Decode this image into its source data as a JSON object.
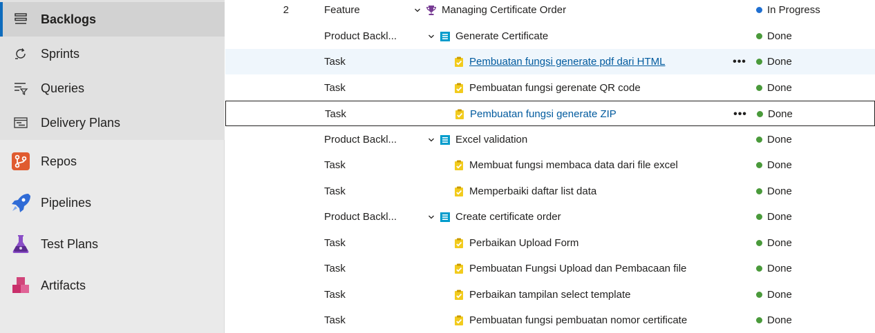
{
  "sidebar": {
    "sub_items": [
      {
        "label": "Backlogs",
        "icon": "backlogs-icon",
        "selected": true
      },
      {
        "label": "Sprints",
        "icon": "sprints-icon",
        "selected": false
      },
      {
        "label": "Queries",
        "icon": "queries-icon",
        "selected": false
      },
      {
        "label": "Delivery Plans",
        "icon": "delivery-plans-icon",
        "selected": false
      }
    ],
    "main_items": [
      {
        "label": "Repos",
        "icon": "repos-icon",
        "color": "#e05b2f"
      },
      {
        "label": "Pipelines",
        "icon": "pipelines-icon",
        "color": "#2f6bd6"
      },
      {
        "label": "Test Plans",
        "icon": "test-plans-icon",
        "color": "#7a3fb0"
      },
      {
        "label": "Artifacts",
        "icon": "artifacts-icon",
        "color": "#d1457a"
      }
    ]
  },
  "colors": {
    "in_progress": "#1f6fd1",
    "done": "#4a9a3b",
    "feature_icon": "#773b93",
    "pbi_icon": "#009ccc",
    "task_icon": "#f2cb1d"
  },
  "backlog": {
    "rows": [
      {
        "order": "2",
        "type": "Feature",
        "level": 0,
        "expandable": true,
        "icon": "trophy-icon",
        "title": "Managing Certificate Order",
        "state": "In Progress",
        "state_color": "#1f6fd1"
      },
      {
        "order": "",
        "type": "Product Backl...",
        "level": 1,
        "expandable": true,
        "icon": "product-backlog-item-icon",
        "title": "Generate Certificate",
        "state": "Done",
        "state_color": "#4a9a3b"
      },
      {
        "order": "",
        "type": "Task",
        "level": 2,
        "expandable": false,
        "icon": "task-icon",
        "title": "Pembuatan fungsi generate pdf dari HTML",
        "state": "Done",
        "state_color": "#4a9a3b",
        "hover": true
      },
      {
        "order": "",
        "type": "Task",
        "level": 2,
        "expandable": false,
        "icon": "task-icon",
        "title": "Pembuatan fungsi gerenate QR code",
        "state": "Done",
        "state_color": "#4a9a3b"
      },
      {
        "order": "",
        "type": "Task",
        "level": 2,
        "expandable": false,
        "icon": "task-icon",
        "title": "Pembuatan fungsi generate ZIP",
        "state": "Done",
        "state_color": "#4a9a3b",
        "focused": true
      },
      {
        "order": "",
        "type": "Product Backl...",
        "level": 1,
        "expandable": true,
        "icon": "product-backlog-item-icon",
        "title": "Excel validation",
        "state": "Done",
        "state_color": "#4a9a3b"
      },
      {
        "order": "",
        "type": "Task",
        "level": 2,
        "expandable": false,
        "icon": "task-icon",
        "title": "Membuat fungsi membaca data dari file excel",
        "state": "Done",
        "state_color": "#4a9a3b"
      },
      {
        "order": "",
        "type": "Task",
        "level": 2,
        "expandable": false,
        "icon": "task-icon",
        "title": "Memperbaiki daftar list data",
        "state": "Done",
        "state_color": "#4a9a3b"
      },
      {
        "order": "",
        "type": "Product Backl...",
        "level": 1,
        "expandable": true,
        "icon": "product-backlog-item-icon",
        "title": "Create certificate order",
        "state": "Done",
        "state_color": "#4a9a3b"
      },
      {
        "order": "",
        "type": "Task",
        "level": 2,
        "expandable": false,
        "icon": "task-icon",
        "title": "Perbaikan Upload Form",
        "state": "Done",
        "state_color": "#4a9a3b"
      },
      {
        "order": "",
        "type": "Task",
        "level": 2,
        "expandable": false,
        "icon": "task-icon",
        "title": "Pembuatan Fungsi Upload dan Pembacaan file",
        "state": "Done",
        "state_color": "#4a9a3b"
      },
      {
        "order": "",
        "type": "Task",
        "level": 2,
        "expandable": false,
        "icon": "task-icon",
        "title": "Perbaikan tampilan select template",
        "state": "Done",
        "state_color": "#4a9a3b"
      },
      {
        "order": "",
        "type": "Task",
        "level": 2,
        "expandable": false,
        "icon": "task-icon",
        "title": "Pembuatan fungsi pembuatan nomor certificate",
        "state": "Done",
        "state_color": "#4a9a3b"
      }
    ]
  }
}
